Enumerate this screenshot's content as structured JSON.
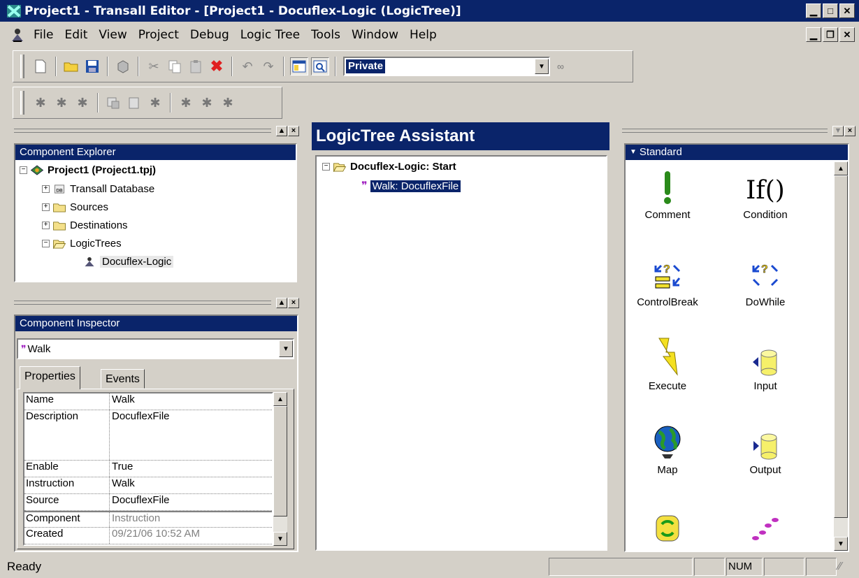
{
  "window": {
    "title": "Project1 - Transall Editor - [Project1 - Docuflex-Logic (LogicTree)]"
  },
  "menu": [
    "File",
    "Edit",
    "View",
    "Project",
    "Debug",
    "Logic Tree",
    "Tools",
    "Window",
    "Help"
  ],
  "toolbar": {
    "combo_value": "Private"
  },
  "explorer": {
    "caption": "Component Explorer",
    "root": "Project1 (Project1.tpj)",
    "items": [
      "Transall Database",
      "Sources",
      "Destinations",
      "LogicTrees"
    ],
    "leaf": "Docuflex-Logic"
  },
  "inspector": {
    "caption": "Component Inspector",
    "selected": "Walk",
    "tabs": [
      "Properties",
      "Events"
    ],
    "properties": [
      {
        "name": "Name",
        "value": "Walk"
      },
      {
        "name": "Description",
        "value": "DocuflexFile"
      },
      {
        "name": "Enable",
        "value": "True"
      },
      {
        "name": "Instruction",
        "value": "Walk"
      },
      {
        "name": "Source",
        "value": "DocuflexFile"
      },
      {
        "name": "Component",
        "value": "Instruction"
      },
      {
        "name": "Created",
        "value": "09/21/06 10:52 AM"
      }
    ]
  },
  "assistant": {
    "title": "LogicTree Assistant",
    "root": "Docuflex-Logic: Start",
    "child": "Walk: DocuflexFile"
  },
  "toolbox": {
    "caption": "Standard",
    "tools": [
      "Comment",
      "Condition",
      "ControlBreak",
      "DoWhile",
      "Execute",
      "Input",
      "Map",
      "Output",
      "",
      ""
    ]
  },
  "status": {
    "text": "Ready",
    "num": "NUM"
  },
  "colors": {
    "title_bg": "#0a246a",
    "face": "#d4d0c8",
    "comment_green": "#2a8a1a",
    "highlight": "#0a246a"
  }
}
